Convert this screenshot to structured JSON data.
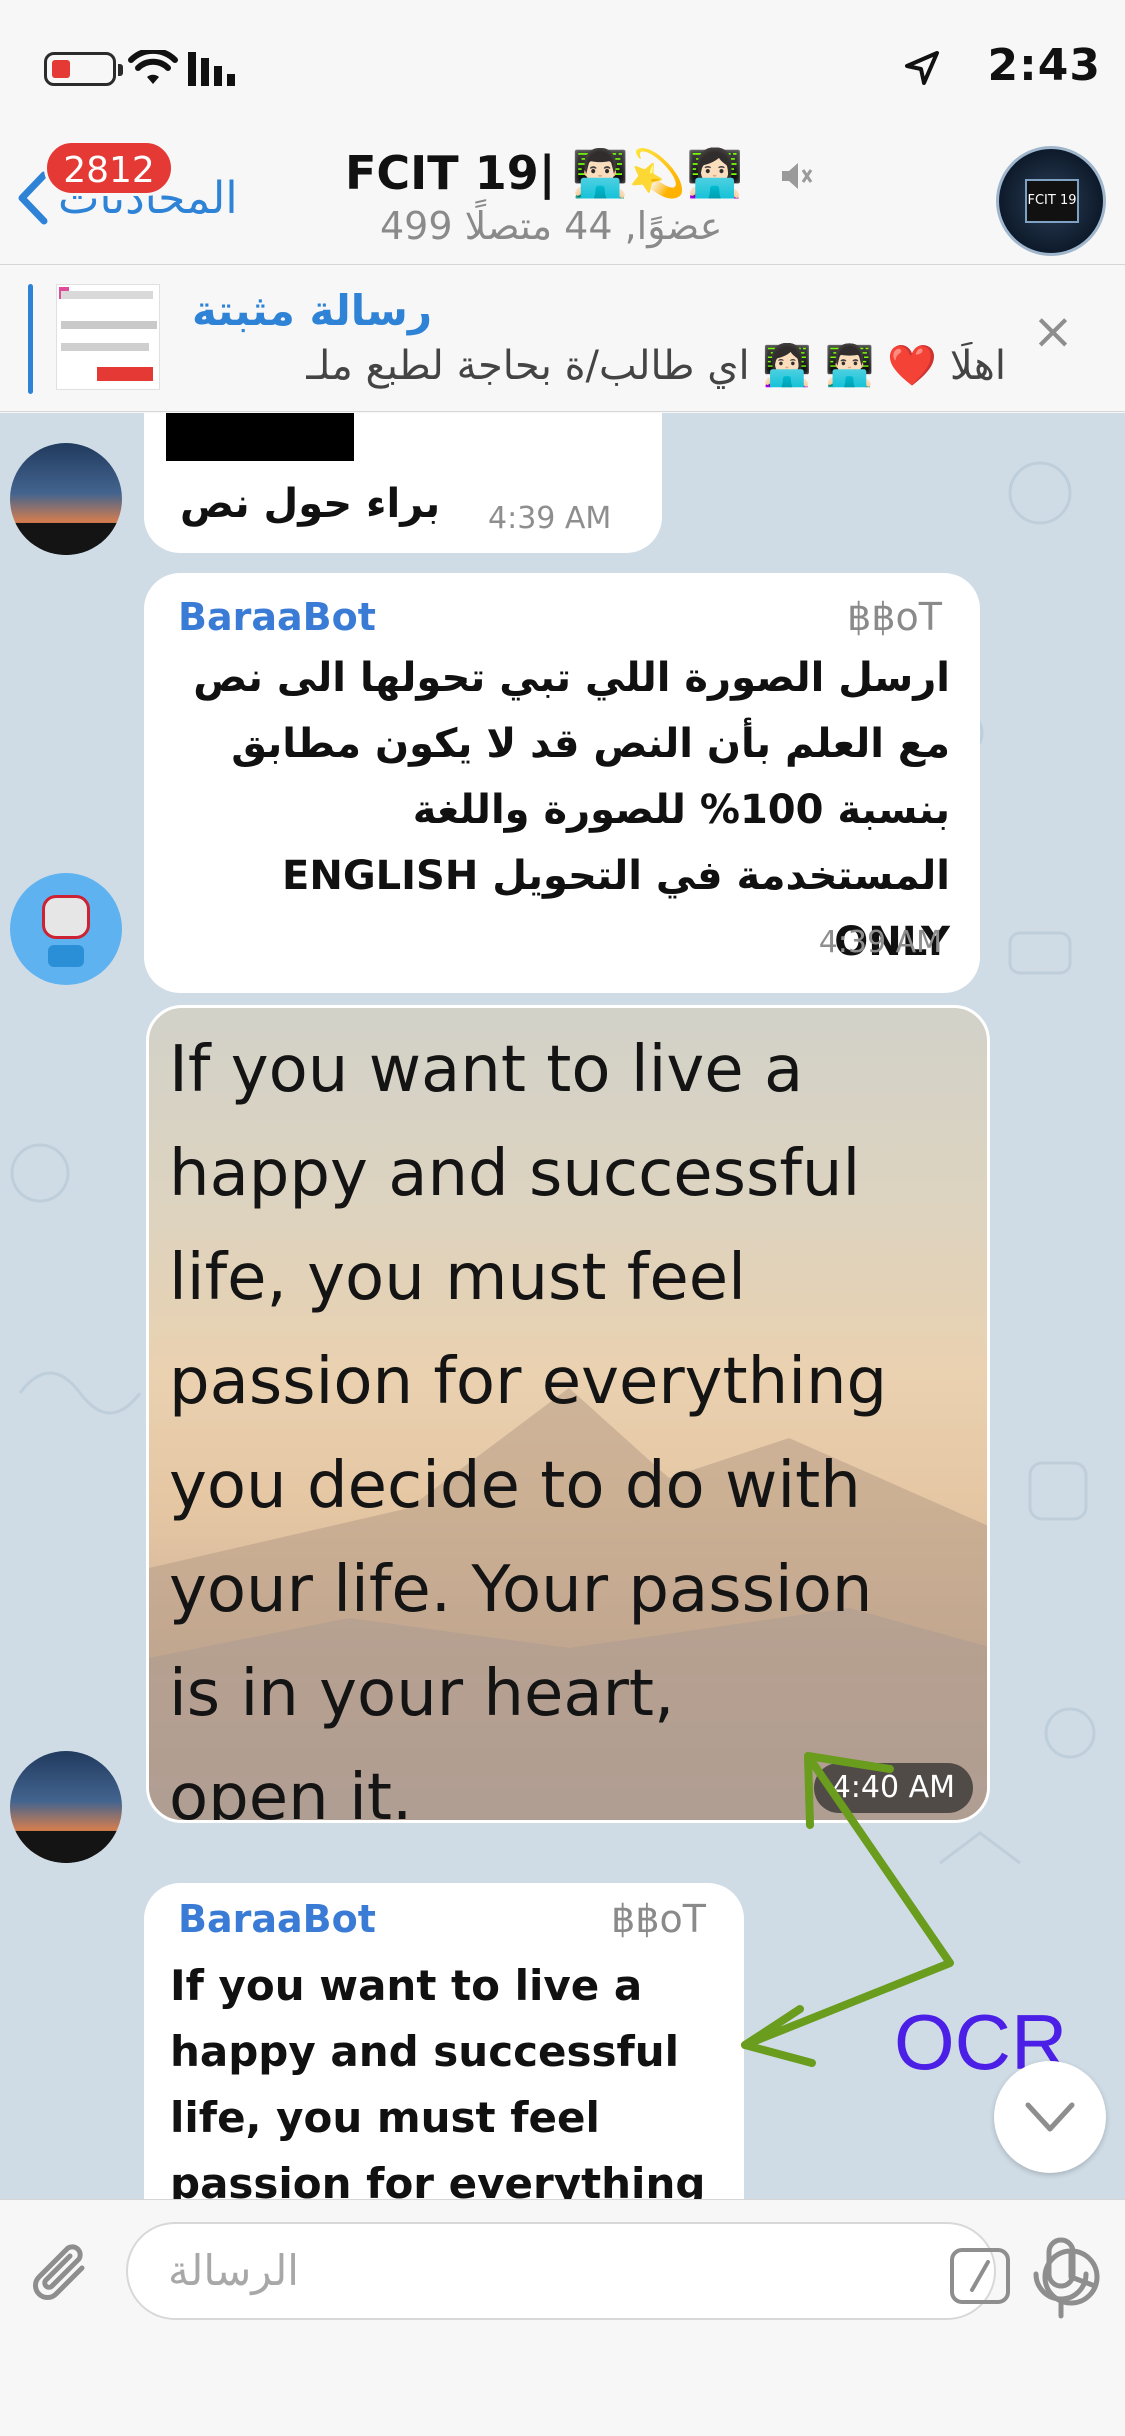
{
  "status_bar": {
    "time": "2:43",
    "battery_level": 0.2,
    "icons": [
      "battery-icon",
      "wifi-icon",
      "signal-icon",
      "location-arrow-icon"
    ]
  },
  "header": {
    "back_label": "المحادثات",
    "unread_count": "2812",
    "title": "FCIT 19| 👨🏻‍💻💫👩🏻‍💻",
    "subtitle": "499 عضوًا, 44 متصلًا",
    "muted_icon": "speaker-muted-icon",
    "avatar_text": "FCIT 19"
  },
  "pinned": {
    "title": "رسالة مثبتة",
    "text": "اهلًا ❤️ 👨🏻‍💻 👩🏻‍💻 اي طالب/ة بحاجة لطبع ملـ"
  },
  "messages": {
    "m1": {
      "text": "براء حول نص",
      "time": "4:39 AM"
    },
    "m2": {
      "sender": "BaraaBot",
      "tag": "฿฿oT",
      "text": "ارسل الصورة اللي تبي تحولها الى نص\n مع العلم بأن النص قد لا يكون مطابق\nبنسبة 100% للصورة واللغة\nالمستخدمة في التحويل ENGLISH\nONLY",
      "time": "4:39 AM"
    },
    "m3": {
      "image_text": "If you want to live a\nhappy and successful\nlife, you must feel\npassion for everything\nyou decide to do with\nyour life. Your passion\nis in your heart,\nopen it.",
      "time": "4:40 AM"
    },
    "m4": {
      "sender": "BaraaBot",
      "tag": "฿฿oT",
      "text": "If you want to live a\nhappy and successful\nlife, you must feel\npassion for everything"
    }
  },
  "annotation": {
    "label": "OCR",
    "color": "#4b1fe6",
    "arrow_color": "#6a9c1e"
  },
  "input": {
    "placeholder": "الرسالة"
  },
  "colors": {
    "accent": "#2f83d6",
    "badge": "#e53935",
    "chat_bg": "#cfdce6"
  }
}
